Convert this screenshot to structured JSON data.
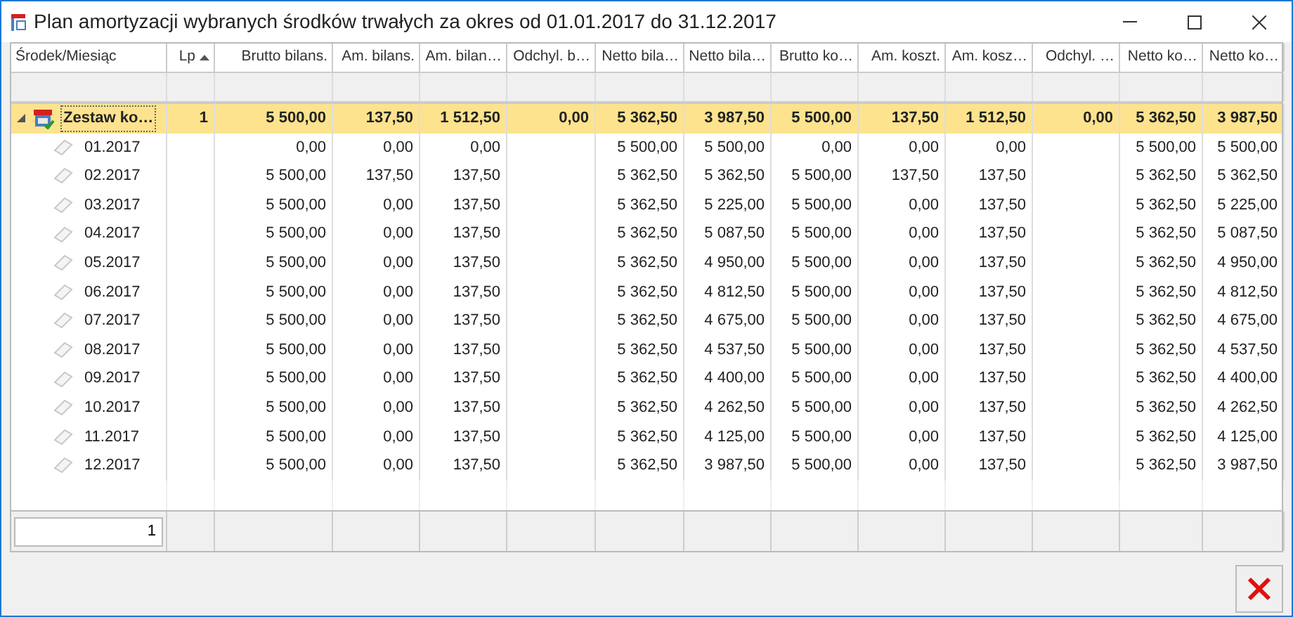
{
  "window": {
    "title": "Plan amortyzacji wybranych środków trwałych za okres od 01.01.2017 do 31.12.2017"
  },
  "table": {
    "columns": [
      {
        "label": "Środek/Miesiąc",
        "sorted": false
      },
      {
        "label": "Lp",
        "sorted": true
      },
      {
        "label": "Brutto bilans.",
        "sorted": false
      },
      {
        "label": "Am. bilans.",
        "sorted": false
      },
      {
        "label": "Am. bilan…",
        "sorted": false
      },
      {
        "label": "Odchyl. b…",
        "sorted": false
      },
      {
        "label": "Netto bila…",
        "sorted": false
      },
      {
        "label": "Netto bila…",
        "sorted": false
      },
      {
        "label": "Brutto ko…",
        "sorted": false
      },
      {
        "label": "Am. koszt.",
        "sorted": false
      },
      {
        "label": "Am. kosz…",
        "sorted": false
      },
      {
        "label": "Odchyl. …",
        "sorted": false
      },
      {
        "label": "Netto ko…",
        "sorted": false
      },
      {
        "label": "Netto ko…",
        "sorted": false
      }
    ],
    "rows": [
      {
        "selected": true,
        "expanded": true,
        "cells": [
          "Zestaw ko…",
          "1",
          "5 500,00",
          "137,50",
          "1 512,50",
          "0,00",
          "5 362,50",
          "3 987,50",
          "5 500,00",
          "137,50",
          "1 512,50",
          "0,00",
          "5 362,50",
          "3 987,50"
        ],
        "children": [
          {
            "selected": false,
            "cells": [
              "01.2017",
              "",
              "0,00",
              "0,00",
              "0,00",
              "",
              "5 500,00",
              "5 500,00",
              "0,00",
              "0,00",
              "0,00",
              "",
              "5 500,00",
              "5 500,00"
            ]
          },
          {
            "selected": false,
            "cells": [
              "02.2017",
              "",
              "5 500,00",
              "137,50",
              "137,50",
              "",
              "5 362,50",
              "5 362,50",
              "5 500,00",
              "137,50",
              "137,50",
              "",
              "5 362,50",
              "5 362,50"
            ]
          },
          {
            "selected": false,
            "cells": [
              "03.2017",
              "",
              "5 500,00",
              "0,00",
              "137,50",
              "",
              "5 362,50",
              "5 225,00",
              "5 500,00",
              "0,00",
              "137,50",
              "",
              "5 362,50",
              "5 225,00"
            ]
          },
          {
            "selected": false,
            "cells": [
              "04.2017",
              "",
              "5 500,00",
              "0,00",
              "137,50",
              "",
              "5 362,50",
              "5 087,50",
              "5 500,00",
              "0,00",
              "137,50",
              "",
              "5 362,50",
              "5 087,50"
            ]
          },
          {
            "selected": false,
            "cells": [
              "05.2017",
              "",
              "5 500,00",
              "0,00",
              "137,50",
              "",
              "5 362,50",
              "4 950,00",
              "5 500,00",
              "0,00",
              "137,50",
              "",
              "5 362,50",
              "4 950,00"
            ]
          },
          {
            "selected": false,
            "cells": [
              "06.2017",
              "",
              "5 500,00",
              "0,00",
              "137,50",
              "",
              "5 362,50",
              "4 812,50",
              "5 500,00",
              "0,00",
              "137,50",
              "",
              "5 362,50",
              "4 812,50"
            ]
          },
          {
            "selected": false,
            "cells": [
              "07.2017",
              "",
              "5 500,00",
              "0,00",
              "137,50",
              "",
              "5 362,50",
              "4 675,00",
              "5 500,00",
              "0,00",
              "137,50",
              "",
              "5 362,50",
              "4 675,00"
            ]
          },
          {
            "selected": false,
            "cells": [
              "08.2017",
              "",
              "5 500,00",
              "0,00",
              "137,50",
              "",
              "5 362,50",
              "4 537,50",
              "5 500,00",
              "0,00",
              "137,50",
              "",
              "5 362,50",
              "4 537,50"
            ]
          },
          {
            "selected": false,
            "cells": [
              "09.2017",
              "",
              "5 500,00",
              "0,00",
              "137,50",
              "",
              "5 362,50",
              "4 400,00",
              "5 500,00",
              "0,00",
              "137,50",
              "",
              "5 362,50",
              "4 400,00"
            ]
          },
          {
            "selected": false,
            "cells": [
              "10.2017",
              "",
              "5 500,00",
              "0,00",
              "137,50",
              "",
              "5 362,50",
              "4 262,50",
              "5 500,00",
              "0,00",
              "137,50",
              "",
              "5 362,50",
              "4 262,50"
            ]
          },
          {
            "selected": false,
            "cells": [
              "11.2017",
              "",
              "5 500,00",
              "0,00",
              "137,50",
              "",
              "5 362,50",
              "4 125,00",
              "5 500,00",
              "0,00",
              "137,50",
              "",
              "5 362,50",
              "4 125,00"
            ]
          },
          {
            "selected": false,
            "cells": [
              "12.2017",
              "",
              "5 500,00",
              "0,00",
              "137,50",
              "",
              "5 362,50",
              "3 987,50",
              "5 500,00",
              "0,00",
              "137,50",
              "",
              "5 362,50",
              "3 987,50"
            ]
          }
        ]
      }
    ],
    "footer": {
      "count": "1"
    }
  }
}
